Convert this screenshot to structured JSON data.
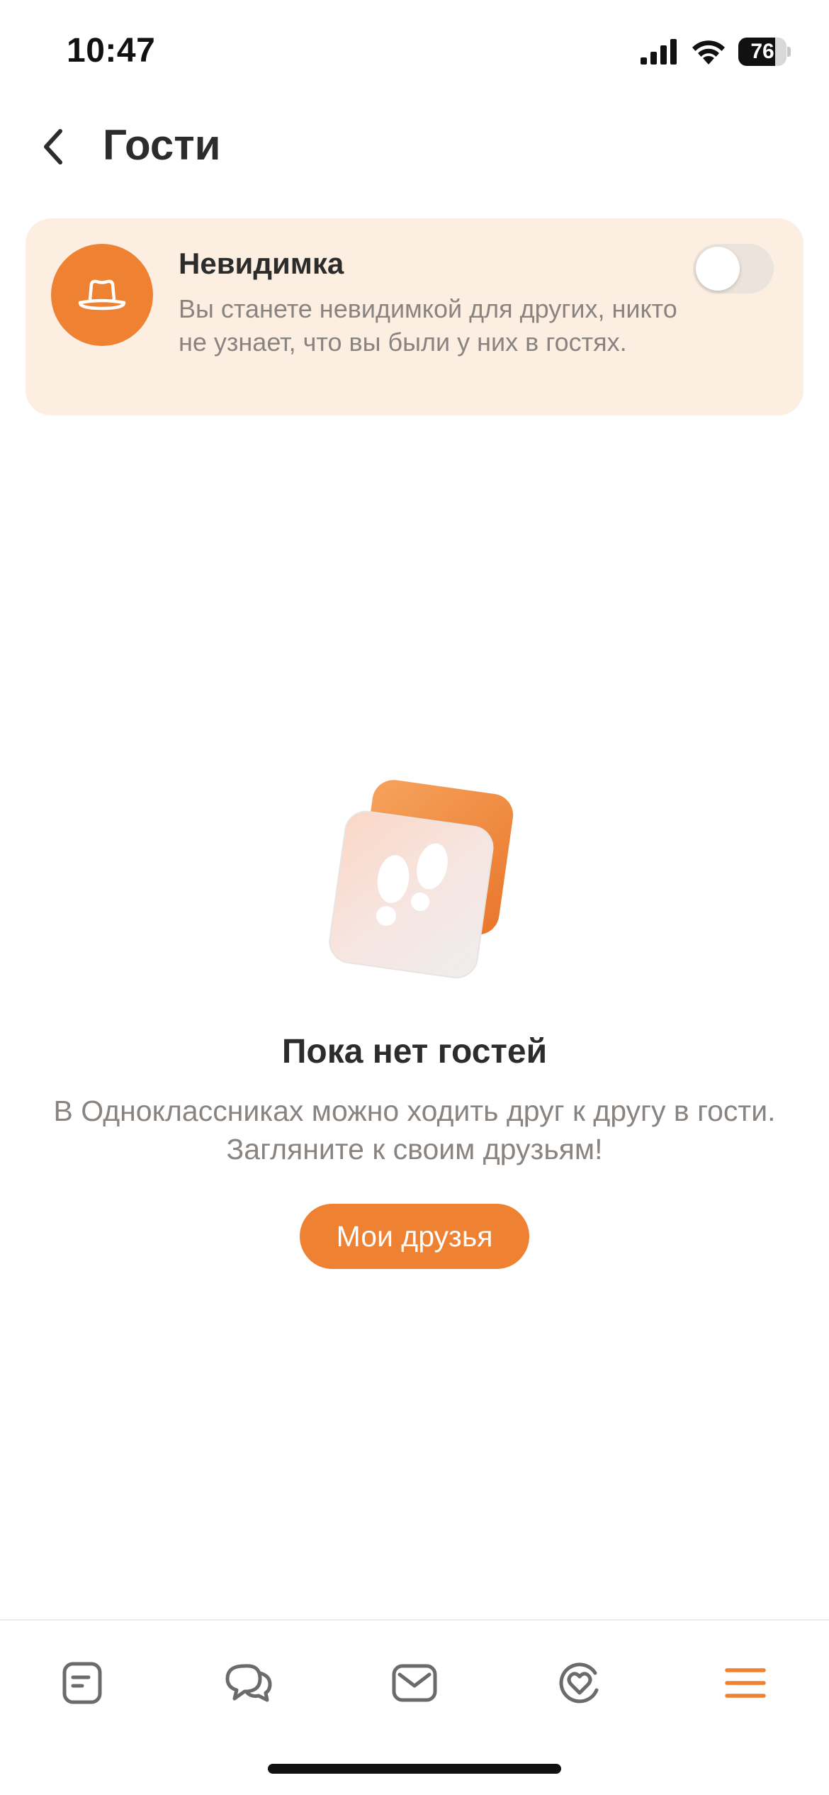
{
  "status_bar": {
    "time": "10:47",
    "battery_level": "76",
    "battery_fraction": 0.76
  },
  "header": {
    "title": "Гости",
    "back_icon": "chevron-left-icon"
  },
  "invisible_card": {
    "title": "Невидимка",
    "description": "Вы станете невидимкой для других, никто не узнает, что вы были у них в гостях.",
    "icon": "hat-icon",
    "toggle_on": false
  },
  "empty_state": {
    "illustration": "footprints-icon",
    "title": "Пока нет гостей",
    "description": "В Одноклассниках можно ходить друг к другу в гости. Загляните к своим друзьям!",
    "button_label": "Мои друзья"
  },
  "tab_bar": {
    "items": [
      {
        "icon": "feed-icon"
      },
      {
        "icon": "discussions-icon"
      },
      {
        "icon": "messages-icon"
      },
      {
        "icon": "dating-icon"
      },
      {
        "icon": "menu-icon",
        "active": true
      }
    ]
  },
  "colors": {
    "accent": "#ee8132",
    "card_background": "#fdeee2",
    "text_primary": "#2c2c2c",
    "text_secondary": "#8a8480",
    "tab_icon": "#6b6b6b"
  }
}
